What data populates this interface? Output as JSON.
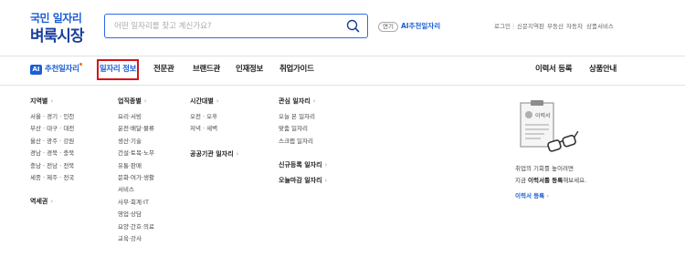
{
  "logo": {
    "line1": "국민 일자리",
    "line2": "벼룩시장"
  },
  "search": {
    "placeholder": "어떤 일자리를 찾고 계신가요?"
  },
  "ai_badge": "연기",
  "ai_link": "AI추천일자리",
  "util_links": [
    "로그인",
    "신문지역판",
    "부동산",
    "자동차",
    "상품서비스"
  ],
  "nav": {
    "ai_label": "AI",
    "ai_recommend": "추천일자리",
    "items": [
      "일자리 정보",
      "전문관",
      "브랜드관",
      "인재정보",
      "취업가이드"
    ],
    "right": [
      "이력서 등록",
      "상품안내"
    ]
  },
  "menu": {
    "region": {
      "title": "지역별",
      "items": [
        "서울 · 경기 · 인천",
        "부산 · 대구 · 대전",
        "울산 · 광주 · 강원",
        "경남 · 경북 · 충북",
        "충남 · 전남 · 전북",
        "세종 · 제주 · 전국"
      ]
    },
    "station": {
      "title": "역세권"
    },
    "industry": {
      "title": "업직종별",
      "items": [
        "요리·서빙",
        "운전·배달·물류",
        "생산·기술",
        "건설·토목·노무",
        "유통·판매",
        "문화·여가·생활",
        "서비스",
        "사무·회계·IT",
        "영업·상담",
        "요양·간호·의료",
        "교육·강사"
      ]
    },
    "time": {
      "title": "시간대별",
      "items": [
        "오전 · 오후",
        "저녁 · 새벽"
      ]
    },
    "public": {
      "title": "공공기관 일자리"
    },
    "interest": {
      "title": "관심 일자리",
      "items": [
        "오늘 본 일자리",
        "맞춤 일자리",
        "스크랩 일자리"
      ]
    },
    "new_jobs": {
      "title": "신규등록 일자리"
    },
    "closing": {
      "title": "오늘마감 일자리"
    }
  },
  "promo": {
    "line1": "취업의 기회를 높이려면",
    "line2_pre": "지금",
    "line2_bold": "이력서를 등록",
    "line2_post": "해보세요.",
    "link": "이력서 등록",
    "doc_label": "이력서"
  },
  "colors": {
    "brand_blue": "#1b5fd6",
    "active_border": "#d6131c",
    "new_dot": "#ff6b00"
  }
}
